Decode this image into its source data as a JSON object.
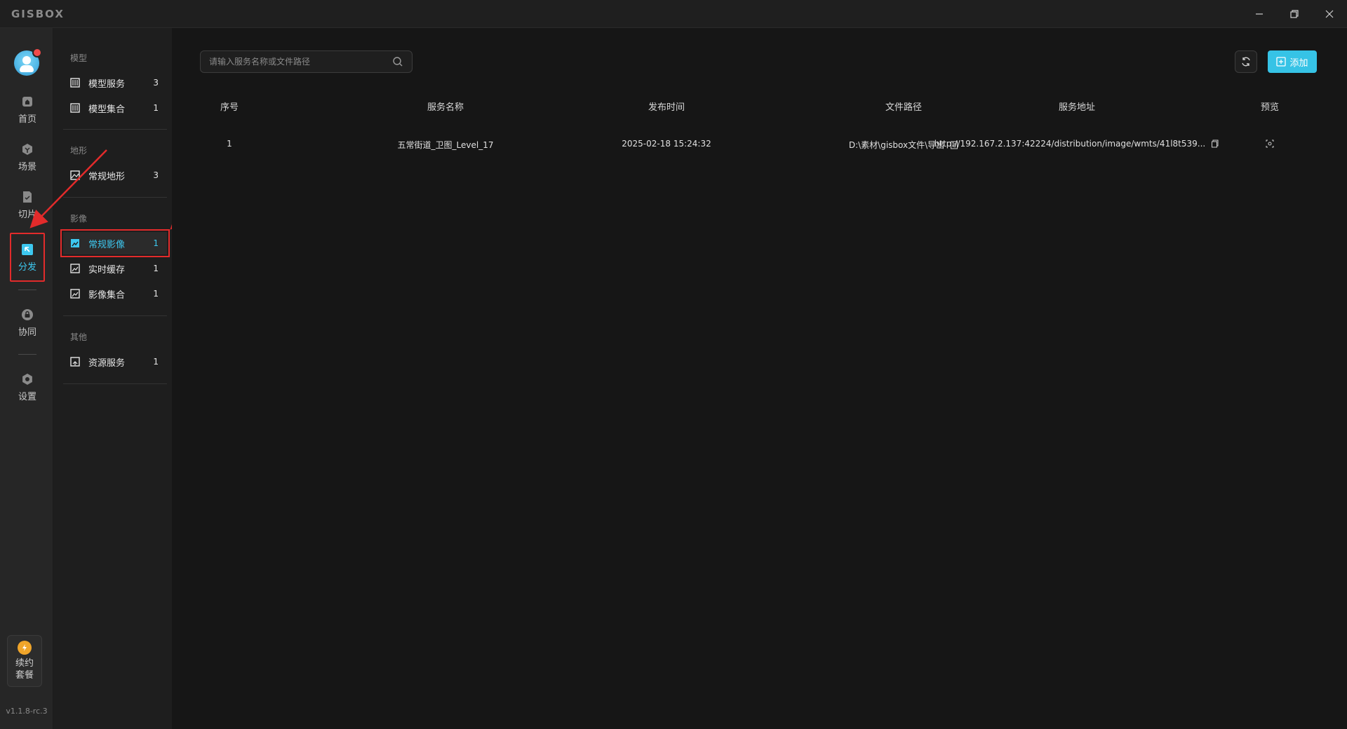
{
  "titlebar": {
    "logo": "GISBOX"
  },
  "rail": {
    "items": [
      {
        "label": "首页",
        "icon": "home-icon"
      },
      {
        "label": "场景",
        "icon": "scene-icon"
      },
      {
        "label": "切片",
        "icon": "tile-icon"
      },
      {
        "label": "分发",
        "icon": "distribute-icon",
        "active": true
      },
      {
        "label": "协同",
        "icon": "lock-icon"
      },
      {
        "label": "设置",
        "icon": "gear-icon"
      }
    ],
    "renew": {
      "line1": "续约",
      "line2": "套餐"
    },
    "version": "v1.1.8-rc.3"
  },
  "side": {
    "sections": [
      {
        "label": "模型",
        "items": [
          {
            "label": "模型服务",
            "count": "3"
          },
          {
            "label": "模型集合",
            "count": "1"
          }
        ]
      },
      {
        "label": "地形",
        "items": [
          {
            "label": "常规地形",
            "count": "3"
          }
        ]
      },
      {
        "label": "影像",
        "items": [
          {
            "label": "常规影像",
            "count": "1",
            "active": true
          },
          {
            "label": "实时缓存",
            "count": "1"
          },
          {
            "label": "影像集合",
            "count": "1"
          }
        ]
      },
      {
        "label": "其他",
        "items": [
          {
            "label": "资源服务",
            "count": "1"
          }
        ]
      }
    ]
  },
  "main": {
    "search_placeholder": "请输入服务名称或文件路径",
    "add_label": "添加",
    "table": {
      "headers": [
        "序号",
        "服务名称",
        "发布时间",
        "文件路径",
        "服务地址",
        "预览"
      ],
      "rows": [
        {
          "index": "1",
          "name": "五常街道_卫图_Level_17",
          "time": "2025-02-18 15:24:32",
          "path": "D:\\素材\\gisbox文件\\导出",
          "url": "http://192.167.2.137:42224/distribution/image/wmts/41l8t539..."
        }
      ]
    }
  },
  "colors": {
    "accent": "#36c3e6",
    "highlight": "#e22b2b"
  }
}
